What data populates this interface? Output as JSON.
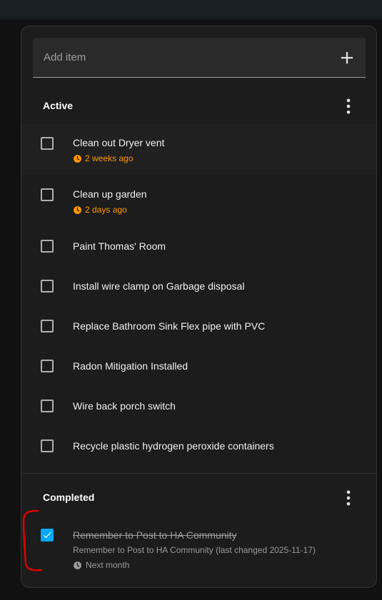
{
  "add_item": {
    "placeholder": "Add item",
    "icon": "plus-icon"
  },
  "sections": {
    "active": {
      "title": "Active",
      "menu_icon": "dots-vertical-icon"
    },
    "completed": {
      "title": "Completed",
      "menu_icon": "dots-vertical-icon"
    }
  },
  "active_items": [
    {
      "title": "Clean out Dryer vent",
      "due": "2 weeks ago",
      "checked": false
    },
    {
      "title": "Clean up garden",
      "due": "2 days ago",
      "checked": false
    },
    {
      "title": "Paint Thomas' Room",
      "checked": false
    },
    {
      "title": "Install wire clamp on Garbage disposal",
      "checked": false
    },
    {
      "title": "Replace Bathroom Sink Flex pipe with PVC",
      "checked": false
    },
    {
      "title": "Radon Mitigation Installed",
      "checked": false
    },
    {
      "title": "Wire back porch switch",
      "checked": false
    },
    {
      "title": "Recycle plastic hydrogen peroxide containers",
      "checked": false
    }
  ],
  "completed_items": [
    {
      "title": "Remember to Post to HA Community",
      "description": "Remember to Post to HA Community (last changed 2025-11-17)",
      "due": "Next month",
      "checked": true
    }
  ],
  "colors": {
    "accent": "#03a9f4",
    "overdue": "#ff9800",
    "annotation": "#e00000",
    "card_bg": "#1c1c1c"
  }
}
